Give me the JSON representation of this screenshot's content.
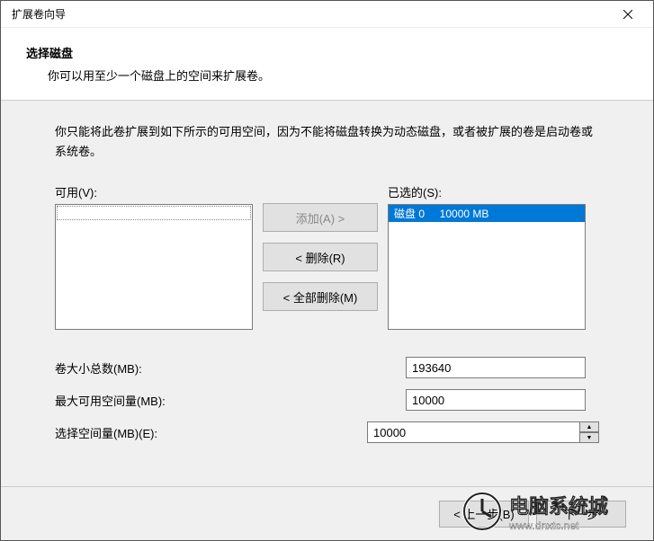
{
  "window": {
    "title": "扩展卷向导"
  },
  "header": {
    "heading": "选择磁盘",
    "subheading": "你可以用至少一个磁盘上的空间来扩展卷。"
  },
  "main": {
    "description": "你只能将此卷扩展到如下所示的可用空间，因为不能将磁盘转换为动态磁盘，或者被扩展的卷是启动卷或系统卷。",
    "available_label": "可用(V):",
    "selected_label": "已选的(S):",
    "selected_items": [
      "磁盘 0     10000 MB"
    ],
    "buttons": {
      "add": "添加(A) >",
      "remove": "< 删除(R)",
      "remove_all": "< 全部删除(M)"
    },
    "fields": {
      "total_label": "卷大小总数(MB):",
      "total_value": "193640",
      "max_label": "最大可用空间量(MB):",
      "max_value": "10000",
      "select_label": "选择空间量(MB)(E):",
      "select_value": "10000"
    }
  },
  "footer": {
    "back": "< 上一步(B)",
    "next": "下一步"
  },
  "watermark": {
    "text": "电脑系统城",
    "url": "www.dnxtc.net"
  }
}
